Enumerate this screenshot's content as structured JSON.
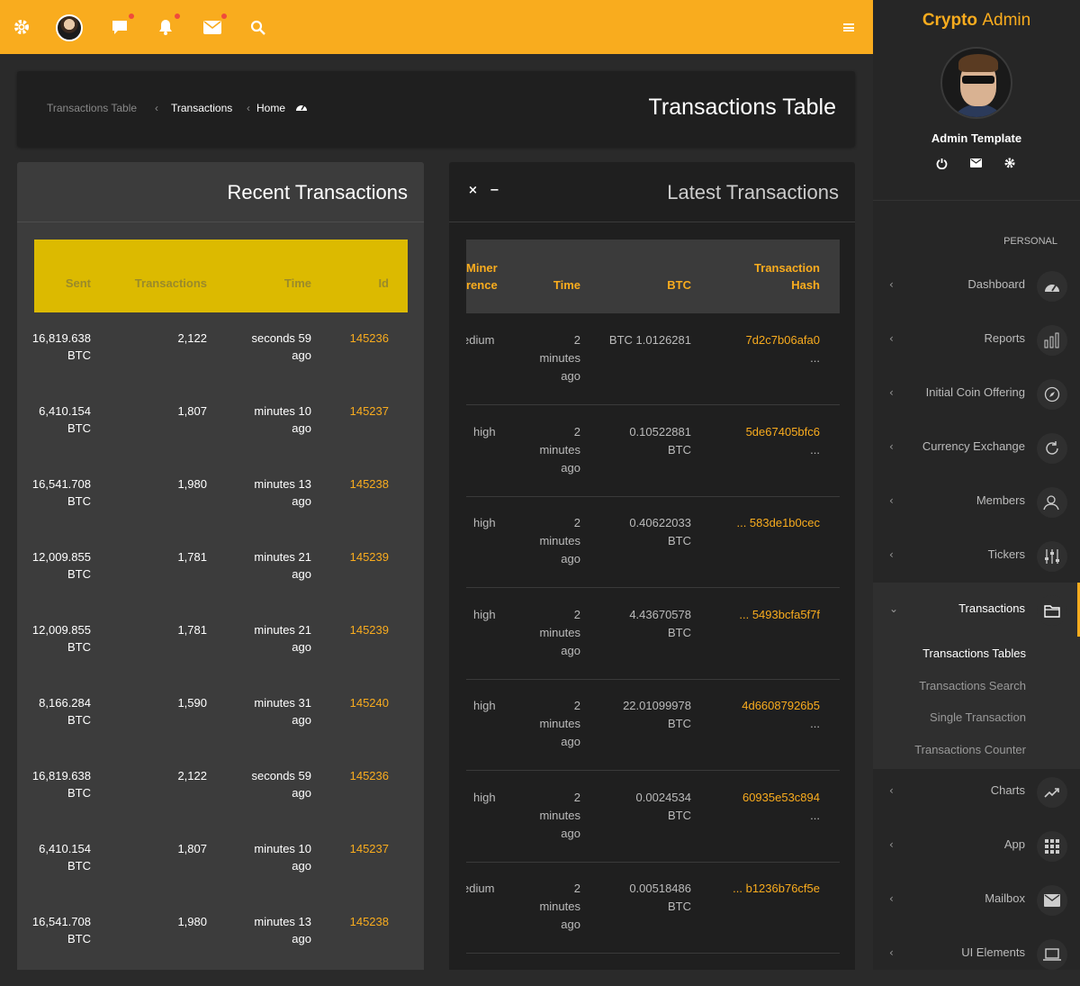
{
  "topbar": {
    "icons": [
      "gear-icon",
      "avatar",
      "chat-icon",
      "bell-icon",
      "mail-icon",
      "search-icon",
      "hamburger-icon"
    ]
  },
  "breadcrumb": {
    "items": [
      "Transactions Table",
      "Transactions",
      "Home"
    ],
    "title": "Transactions Table"
  },
  "recent": {
    "title": "Recent Transactions",
    "columns": [
      "Sent",
      "Transactions",
      "Time",
      "Id"
    ],
    "rows": [
      {
        "sent1": "16,819.638",
        "sent2": "BTC",
        "tx": "2,122",
        "time1": "seconds 59",
        "time2": "ago",
        "id": "145236"
      },
      {
        "sent1": "6,410.154",
        "sent2": "BTC",
        "tx": "1,807",
        "time1": "minutes 10",
        "time2": "ago",
        "id": "145237"
      },
      {
        "sent1": "16,541.708",
        "sent2": "BTC",
        "tx": "1,980",
        "time1": "minutes 13",
        "time2": "ago",
        "id": "145238"
      },
      {
        "sent1": "12,009.855",
        "sent2": "BTC",
        "tx": "1,781",
        "time1": "minutes 21",
        "time2": "ago",
        "id": "145239"
      },
      {
        "sent1": "12,009.855",
        "sent2": "BTC",
        "tx": "1,781",
        "time1": "minutes 21",
        "time2": "ago",
        "id": "145239"
      },
      {
        "sent1": "8,166.284",
        "sent2": "BTC",
        "tx": "1,590",
        "time1": "minutes 31",
        "time2": "ago",
        "id": "145240"
      },
      {
        "sent1": "16,819.638",
        "sent2": "BTC",
        "tx": "2,122",
        "time1": "seconds 59",
        "time2": "ago",
        "id": "145236"
      },
      {
        "sent1": "6,410.154",
        "sent2": "BTC",
        "tx": "1,807",
        "time1": "minutes 10",
        "time2": "ago",
        "id": "145237"
      },
      {
        "sent1": "16,541.708",
        "sent2": "BTC",
        "tx": "1,980",
        "time1": "minutes 13",
        "time2": "ago",
        "id": "145238"
      }
    ]
  },
  "latest": {
    "title": "Latest Transactions",
    "close": "×",
    "minimize": "−",
    "columns": {
      "miner1": "Miner",
      "miner2": "rence",
      "time": "Time",
      "btc": "BTC",
      "hash1": "Transaction",
      "hash2": "Hash"
    },
    "rows": [
      {
        "miner": "edium",
        "t1": "2",
        "t2": "minutes",
        "t3": "ago",
        "b1": "BTC 1.0126281",
        "b2": "",
        "h1": "7d2c7b06afa0",
        "h2": "..."
      },
      {
        "miner": "high",
        "t1": "2",
        "t2": "minutes",
        "t3": "ago",
        "b1": "0.10522881",
        "b2": "BTC",
        "h1": "5de67405bfc6",
        "h2": "..."
      },
      {
        "miner": "high",
        "t1": "2",
        "t2": "minutes",
        "t3": "ago",
        "b1": "0.40622033",
        "b2": "BTC",
        "h1": "... 583de1b0cec",
        "h2": ""
      },
      {
        "miner": "high",
        "t1": "2",
        "t2": "minutes",
        "t3": "ago",
        "b1": "4.43670578",
        "b2": "BTC",
        "h1": "... 5493bcfa5f7f",
        "h2": ""
      },
      {
        "miner": "high",
        "t1": "2",
        "t2": "minutes",
        "t3": "ago",
        "b1": "22.01099978",
        "b2": "BTC",
        "h1": "4d66087926b5",
        "h2": "..."
      },
      {
        "miner": "high",
        "t1": "2",
        "t2": "minutes",
        "t3": "ago",
        "b1": "0.0024534",
        "b2": "BTC",
        "h1": "60935e53c894",
        "h2": "..."
      },
      {
        "miner": "edium",
        "t1": "2",
        "t2": "minutes",
        "t3": "ago",
        "b1": "0.00518486",
        "b2": "BTC",
        "h1": "... b1236b76cf5e",
        "h2": ""
      }
    ]
  },
  "sidebar": {
    "brand1": "Crypto",
    "brand2": "Admin",
    "profile_name": "Admin Template",
    "section": "PERSONAL",
    "items": [
      {
        "label": "Dashboard",
        "icon": "dashboard-icon"
      },
      {
        "label": "Reports",
        "icon": "bar-chart-icon"
      },
      {
        "label": "Initial Coin Offering",
        "icon": "compass-icon"
      },
      {
        "label": "Currency Exchange",
        "icon": "refresh-icon"
      },
      {
        "label": "Members",
        "icon": "users-icon"
      },
      {
        "label": "Tickers",
        "icon": "sliders-icon"
      },
      {
        "label": "Transactions",
        "icon": "folder-icon"
      }
    ],
    "subitems": [
      "Transactions Tables",
      "Transactions Search",
      "Single Transaction",
      "Transactions Counter"
    ],
    "items2": [
      {
        "label": "Charts",
        "icon": "trend-icon"
      },
      {
        "label": "App",
        "icon": "grid-icon"
      },
      {
        "label": "Mailbox",
        "icon": "mail-icon"
      },
      {
        "label": "UI Elements",
        "icon": "laptop-icon"
      }
    ]
  },
  "colors": {
    "accent": "#f9ac1e",
    "header_yellow": "#dcba00"
  }
}
